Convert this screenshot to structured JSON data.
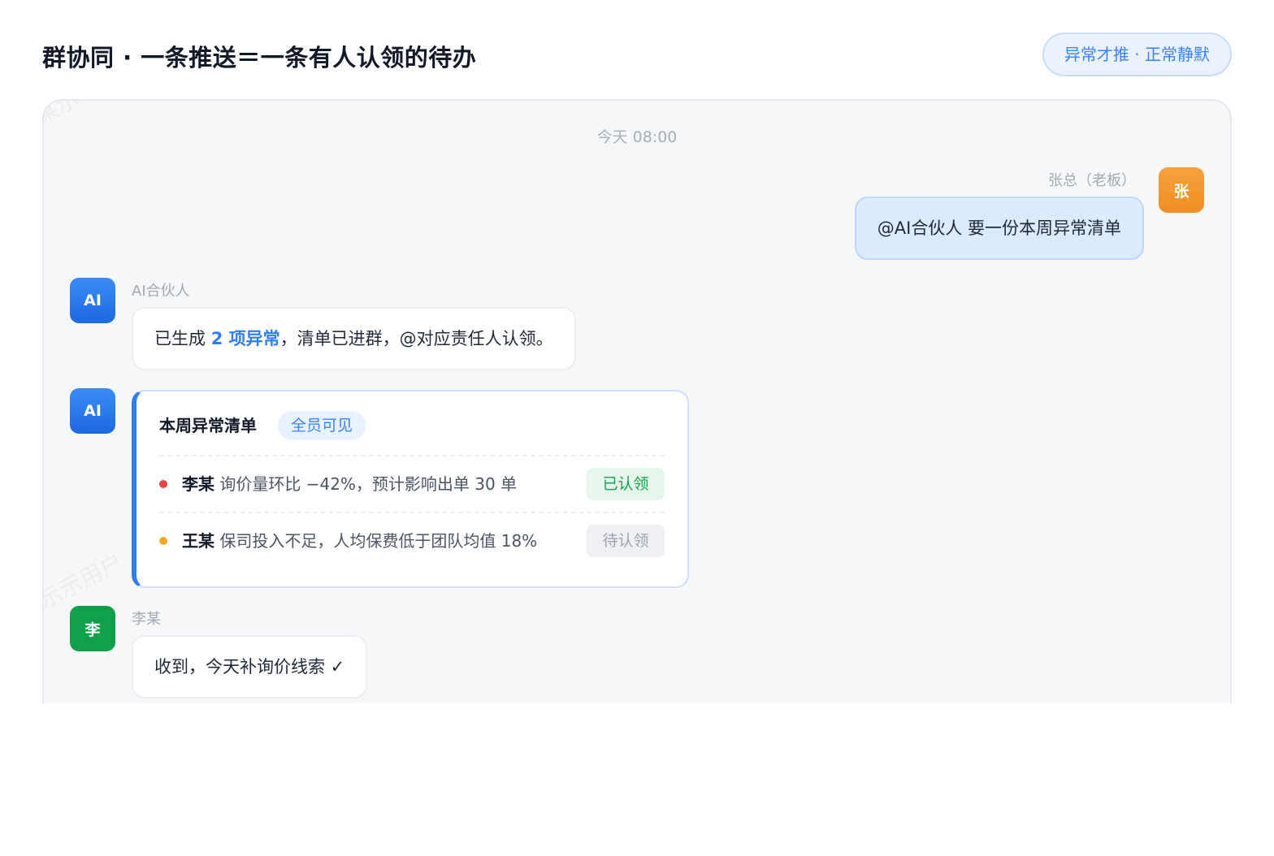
{
  "header": {
    "title": "群协同 · 一条推送＝一条有人认领的待办",
    "mode_pill": "异常才推 · 正常静默"
  },
  "chat": {
    "time_divider": "今天 08:00",
    "messages": {
      "boss": {
        "avatar": "张",
        "sender": "张总（老板）",
        "text": "@AI合伙人 要一份本周异常清单"
      },
      "ai_reply": {
        "avatar": "AI",
        "sender": "AI合伙人",
        "text_before": "已生成 ",
        "highlight": "2 项异常",
        "text_after": "，清单已进群，@对应责任人认领。"
      },
      "ai_card": {
        "avatar": "AI",
        "title": "本周异常清单",
        "tag": "全员可见",
        "items": [
          {
            "name": "李某",
            "desc": "询价量环比 −42%，预计影响出单 30 单",
            "status": "已认领",
            "dot_color": "#ef4444"
          },
          {
            "name": "王某",
            "desc": "保司投入不足，人均保费低于团队均值 18%",
            "status": "待认领",
            "dot_color": "#f5a623"
          }
        ]
      },
      "li_reply": {
        "avatar": "李",
        "sender": "李某",
        "text": "收到，今天补询价线索 ✓"
      }
    }
  },
  "watermark": "张某某示示用户"
}
